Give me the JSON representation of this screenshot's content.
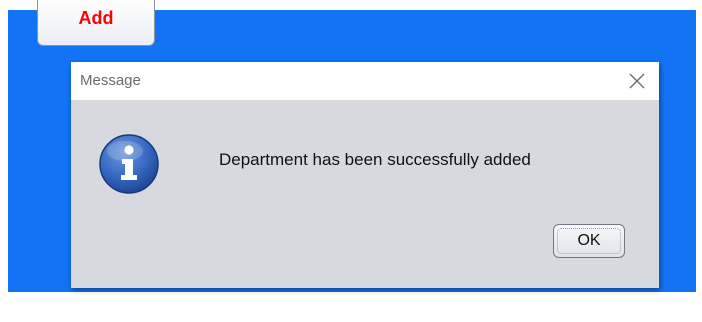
{
  "toolbar": {
    "add_label": "Add"
  },
  "dialog": {
    "title": "Message",
    "message": "Department has been successfully added",
    "ok_label": "OK",
    "icon": "info-icon",
    "close_icon": "close-icon"
  },
  "colors": {
    "app_background": "#1274f5",
    "add_label": "#ff0000",
    "dialog_body": "#d7d9de",
    "info_icon": "#2f5fb8"
  }
}
